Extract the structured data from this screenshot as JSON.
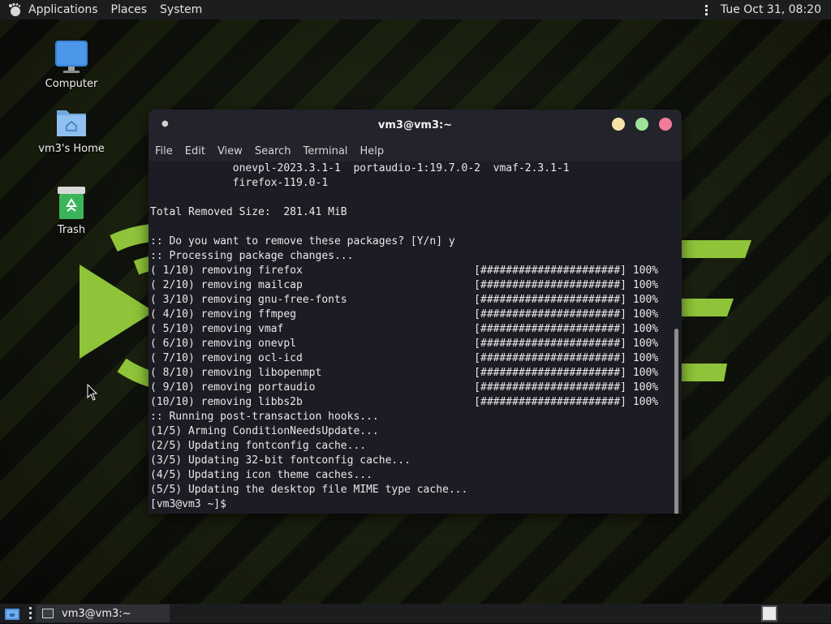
{
  "top_panel": {
    "applications": "Applications",
    "places": "Places",
    "system": "System",
    "clock": "Tue Oct 31, 08:20"
  },
  "desktop": {
    "icons": [
      {
        "label": "Computer",
        "icon": "monitor-icon"
      },
      {
        "label": "vm3's Home",
        "icon": "home-folder-icon"
      },
      {
        "label": "Trash",
        "icon": "trash-icon"
      }
    ]
  },
  "terminal": {
    "title": "vm3@vm3:~",
    "menu": [
      "File",
      "Edit",
      "View",
      "Search",
      "Terminal",
      "Help"
    ],
    "lines": [
      "             onevpl-2023.3.1-1  portaudio-1:19.7.0-2  vmaf-2.3.1-1",
      "             firefox-119.0-1",
      "",
      "Total Removed Size:  281.41 MiB",
      "",
      ":: Do you want to remove these packages? [Y/n] y",
      ":: Processing package changes...",
      "( 1/10) removing firefox                           [######################] 100%",
      "( 2/10) removing mailcap                           [######################] 100%",
      "( 3/10) removing gnu-free-fonts                    [######################] 100%",
      "( 4/10) removing ffmpeg                            [######################] 100%",
      "( 5/10) removing vmaf                              [######################] 100%",
      "( 6/10) removing onevpl                            [######################] 100%",
      "( 7/10) removing ocl-icd                           [######################] 100%",
      "( 8/10) removing libopenmpt                        [######################] 100%",
      "( 9/10) removing portaudio                         [######################] 100%",
      "(10/10) removing libbs2b                           [######################] 100%",
      ":: Running post-transaction hooks...",
      "(1/5) Arming ConditionNeedsUpdate...",
      "(2/5) Updating fontconfig cache...",
      "(3/5) Updating 32-bit fontconfig cache...",
      "(4/5) Updating icon theme caches...",
      "(5/5) Updating the desktop file MIME type cache...",
      "[vm3@vm3 ~]$ "
    ],
    "buttons": {
      "minimize_color": "#f7e3a8",
      "maximize_color": "#9fe29a",
      "close_color": "#f27b9c"
    }
  },
  "bottom_panel": {
    "task_label": "vm3@vm3:~"
  },
  "colors": {
    "accent_green": "#8fc43a",
    "terminal_bg": "#1c1c24"
  }
}
